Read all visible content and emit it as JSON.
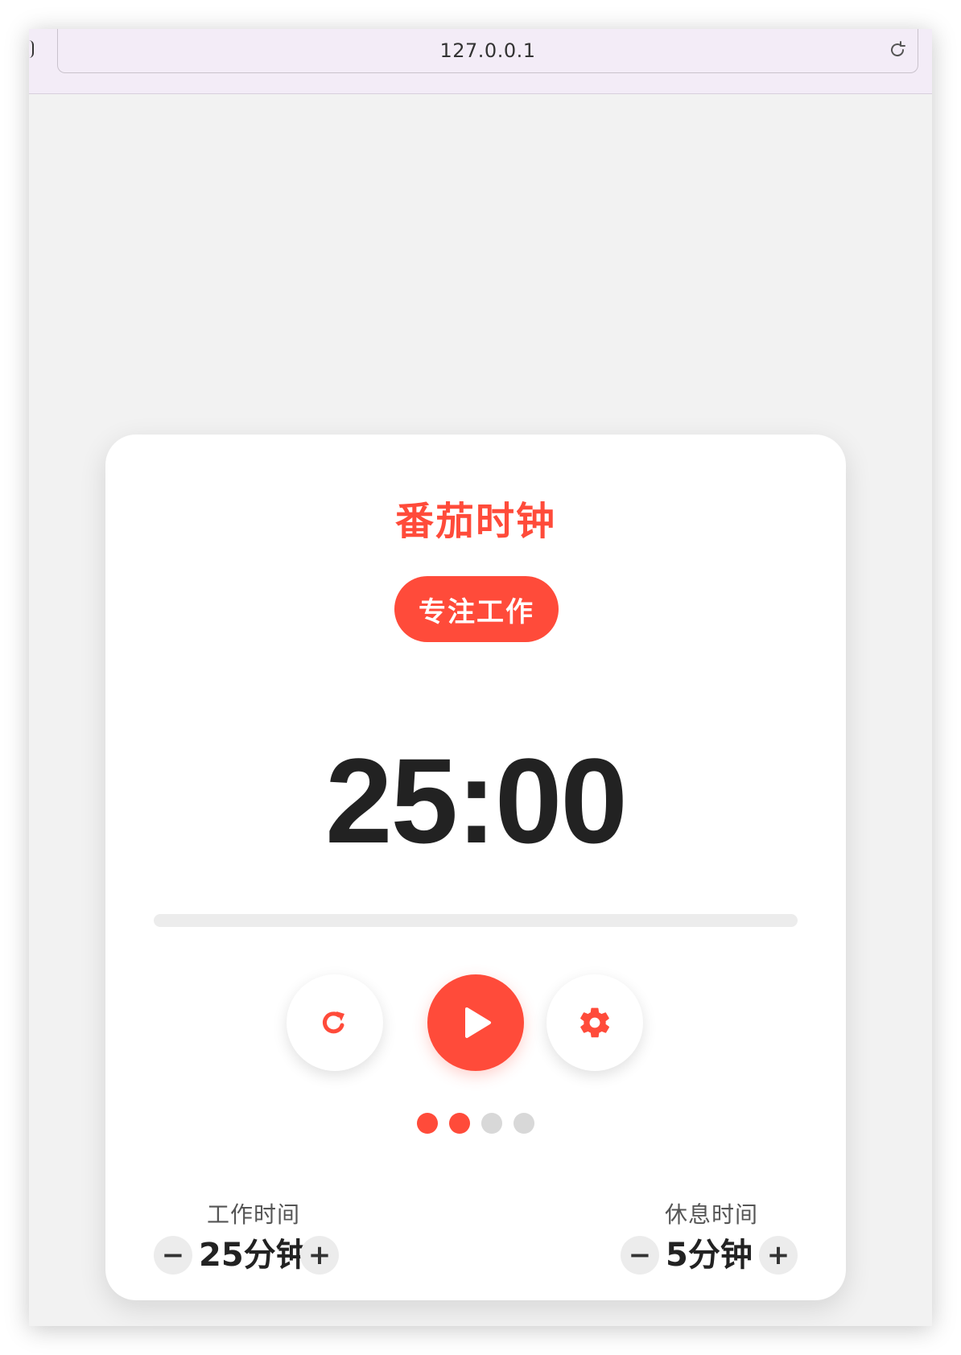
{
  "browser": {
    "url": "127.0.0.1"
  },
  "app": {
    "title": "番茄时钟",
    "mode_label": "专注工作",
    "timer": "25:00",
    "progress_fraction": 0,
    "accent_color": "#ff4b3a",
    "controls": {
      "reset_icon": "reset-icon",
      "play_icon": "play-icon",
      "settings_icon": "gear-icon"
    },
    "session_dots": {
      "total": 4,
      "completed": 2
    },
    "settings": {
      "work": {
        "label": "工作时间",
        "value": "25分钟",
        "minus": "−",
        "plus": "+"
      },
      "break": {
        "label": "休息时间",
        "value": "5分钟",
        "minus": "−",
        "plus": "+"
      }
    }
  }
}
